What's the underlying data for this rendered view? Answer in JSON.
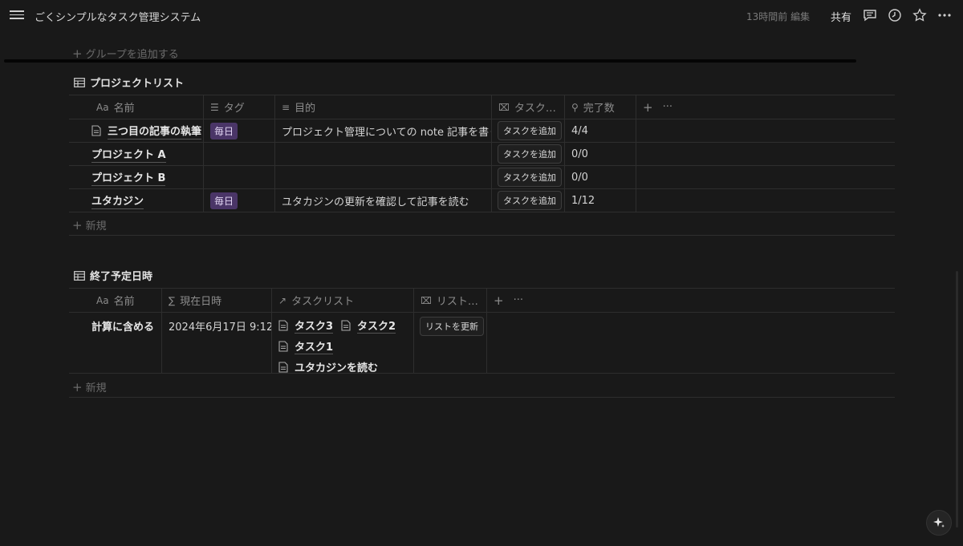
{
  "topbar": {
    "title": "ごくシンプルなタスク管理システム",
    "edited": "13時間前 編集",
    "share_label": "共有"
  },
  "add_group_label": "グループを追加する",
  "projects": {
    "title": "プロジェクトリスト",
    "columns": {
      "name": "名前",
      "name_prefix": "Aa",
      "tag": "タグ",
      "purpose": "目的",
      "task": "タスク…",
      "done": "完了数"
    },
    "rows": [
      {
        "name": "三つ目の記事の執筆",
        "tag": "毎日",
        "purpose": "プロジェクト管理についての note 記事を書く",
        "button": "タスクを追加",
        "done": "4/4"
      },
      {
        "name": "プロジェクト A",
        "tag": "",
        "purpose": "",
        "button": "タスクを追加",
        "done": "0/0"
      },
      {
        "name": "プロジェクト B",
        "tag": "",
        "purpose": "",
        "button": "タスクを追加",
        "done": "0/0"
      },
      {
        "name": "ユタカジン",
        "tag": "毎日",
        "purpose": "ユタカジンの更新を確認して記事を読む",
        "button": "タスクを追加",
        "done": "1/12"
      }
    ],
    "new_label": "新規"
  },
  "schedule": {
    "title": "終了予定日時",
    "columns": {
      "name": "名前",
      "name_prefix": "Aa",
      "now": "現在日時",
      "tasklist": "タスクリスト",
      "list": "リスト…"
    },
    "row": {
      "name": "計算に含める",
      "now": "2024年6月17日 9:12",
      "tasks": [
        "タスク3",
        "タスク2",
        "タスク1",
        "ユタカジンを読む"
      ],
      "button": "リストを更新"
    },
    "new_label": "新規"
  },
  "colors": {
    "background": "#191919",
    "tag_bg": "#4a3567"
  }
}
